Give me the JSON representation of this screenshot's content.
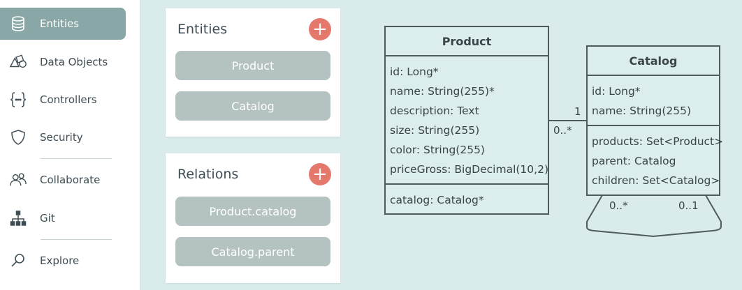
{
  "sidebar": {
    "items": [
      {
        "label": "Entities",
        "icon": "database-icon",
        "active": true
      },
      {
        "label": "Data Objects",
        "icon": "shapes-icon"
      },
      {
        "label": "Controllers",
        "icon": "braces-icon"
      },
      {
        "label": "Security",
        "icon": "shield-icon"
      },
      {
        "label": "Collaborate",
        "icon": "people-icon"
      },
      {
        "label": "Git",
        "icon": "git-tree-icon"
      },
      {
        "label": "Explore",
        "icon": "magnifier-icon"
      }
    ]
  },
  "entities_panel": {
    "title": "Entities",
    "add_symbol": "+",
    "items": [
      "Product",
      "Catalog"
    ]
  },
  "relations_panel": {
    "title": "Relations",
    "add_symbol": "+",
    "items": [
      "Product.catalog",
      "Catalog.parent"
    ]
  },
  "diagram": {
    "product": {
      "name": "Product",
      "attributes": [
        "id: Long*",
        "name: String(255)*",
        "description: Text",
        "size: String(255)",
        "color: String(255)",
        "priceGross: BigDecimal(10,2)"
      ],
      "relations": [
        "catalog: Catalog*"
      ]
    },
    "catalog": {
      "name": "Catalog",
      "attributes": [
        "id: Long*",
        "name: String(255)"
      ],
      "relations": [
        "products: Set<Product>",
        "parent: Catalog",
        "children: Set<Catalog>"
      ]
    },
    "multiplicity": {
      "catalog_end": "1",
      "product_end": "0..*",
      "self_many": "0..*",
      "self_one": "0..1"
    }
  },
  "colors": {
    "accent": "#e4786a",
    "active_nav": "#89a7a6",
    "pill": "#b4c2c2",
    "canvas": "#d9ebeb",
    "uml_border": "#4d5a5e"
  }
}
